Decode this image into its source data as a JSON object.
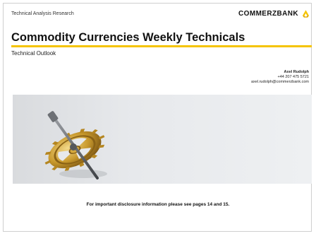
{
  "header": {
    "department": "Technical Analysis Research",
    "brand": "COMMERZBANK",
    "brand_color": "#f5c400"
  },
  "document": {
    "title": "Commodity Currencies Weekly Technicals",
    "subtitle": "Technical Outlook"
  },
  "author": {
    "name": "Axel Rudolph",
    "phone": "+44 207 475 5721",
    "email": "axel.rudolph@commerzbank.com"
  },
  "image": {
    "icon": "gear-wheel-icon"
  },
  "footer": {
    "disclosure": "For important disclosure information please see pages 14 and 15."
  }
}
